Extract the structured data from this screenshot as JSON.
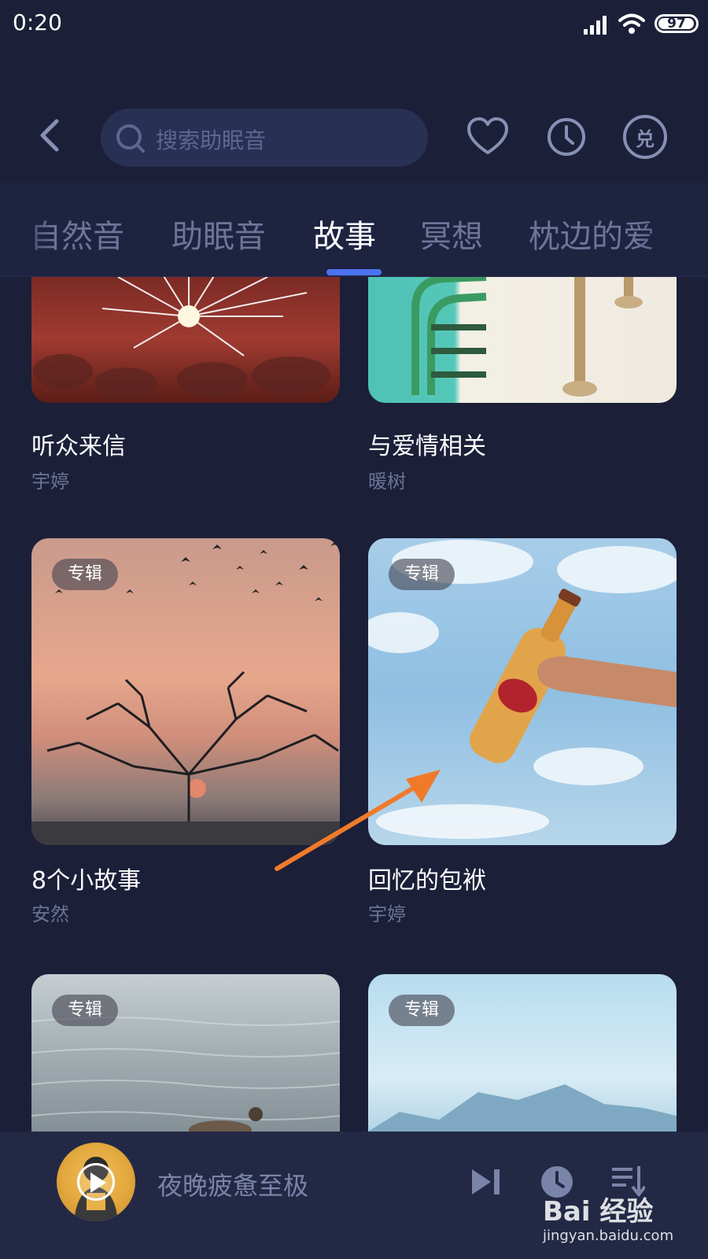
{
  "status_bar": {
    "time": "0:20",
    "battery": "97",
    "battery_level": 0.97
  },
  "header": {
    "search_placeholder": "搜索助眠音",
    "redeem_glyph": "兑"
  },
  "tabs": [
    {
      "label": "自然音",
      "active": false
    },
    {
      "label": "助眠音",
      "active": false
    },
    {
      "label": "故事",
      "active": true
    },
    {
      "label": "冥想",
      "active": false
    },
    {
      "label": "枕边的爱",
      "active": false
    }
  ],
  "cards": [
    {
      "title": "听众来信",
      "author": "宇婷",
      "badge": ""
    },
    {
      "title": "与爱情相关",
      "author": "暖树",
      "badge": ""
    },
    {
      "title": "8个小故事",
      "author": "安然",
      "badge": "专辑"
    },
    {
      "title": "回忆的包袱",
      "author": "宇婷",
      "badge": "专辑"
    },
    {
      "title": "",
      "author": "",
      "badge": "专辑"
    },
    {
      "title": "",
      "author": "",
      "badge": "专辑"
    }
  ],
  "player": {
    "track_title": "夜晚疲惫至极"
  },
  "watermark": {
    "logo": "Bai 经验",
    "url": "jingyan.baidu.com"
  },
  "colors": {
    "background": "#1b1f38",
    "accent": "#4b73f0",
    "annotation": "#f07a2a"
  }
}
